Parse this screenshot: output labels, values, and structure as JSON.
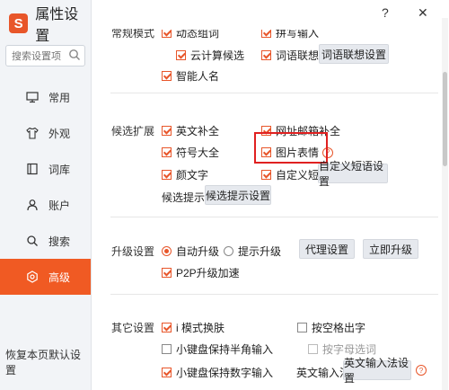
{
  "app": {
    "logo_char": "S",
    "title": "属性设置",
    "help_btn": "?",
    "close_btn": "✕"
  },
  "search": {
    "placeholder": "搜索设置项"
  },
  "sidebar": {
    "items": [
      {
        "label": "常用",
        "icon": "monitor-icon",
        "active": false
      },
      {
        "label": "外观",
        "icon": "shirt-icon",
        "active": false
      },
      {
        "label": "词库",
        "icon": "book-icon",
        "active": false
      },
      {
        "label": "账户",
        "icon": "user-icon",
        "active": false
      },
      {
        "label": "搜索",
        "icon": "search-icon",
        "active": false
      },
      {
        "label": "高级",
        "icon": "gear-icon",
        "active": true
      }
    ],
    "restore_label": "恢复本页默认设置"
  },
  "sections": {
    "common_mode": {
      "label": "常规模式",
      "top_left": "动态组词",
      "top_right": "拼写输入",
      "cloud": "云计算候选",
      "assoc": "词语联想",
      "assoc_btn": "词语联想设置",
      "smart_name": "智能人名"
    },
    "candidate_ext": {
      "label": "候选扩展",
      "english": "英文补全",
      "email": "网址邮箱补全",
      "symbols": "符号大全",
      "picture": "图片表情",
      "emoticon": "颜文字",
      "custom_phrase": "自定义短语",
      "custom_phrase_btn": "自定义短语设置",
      "tip_label": "候选提示",
      "tip_btn": "候选提示设置"
    },
    "upgrade": {
      "label": "升级设置",
      "auto": "自动升级",
      "prompt": "提示升级",
      "proxy_btn": "代理设置",
      "now_btn": "立即升级",
      "p2p": "P2P升级加速"
    },
    "other": {
      "label": "其它设置",
      "i_mode": "i 模式换肤",
      "space_out": "按空格出字",
      "mini_half": "小键盘保持半角输入",
      "letter_select": "按字母选词",
      "mini_num": "小键盘保持数字输入",
      "en_method_label": "英文输入法",
      "en_method_btn": "英文输入法设置"
    }
  },
  "colors": {
    "accent": "#f05a23",
    "highlight": "#e02020"
  }
}
